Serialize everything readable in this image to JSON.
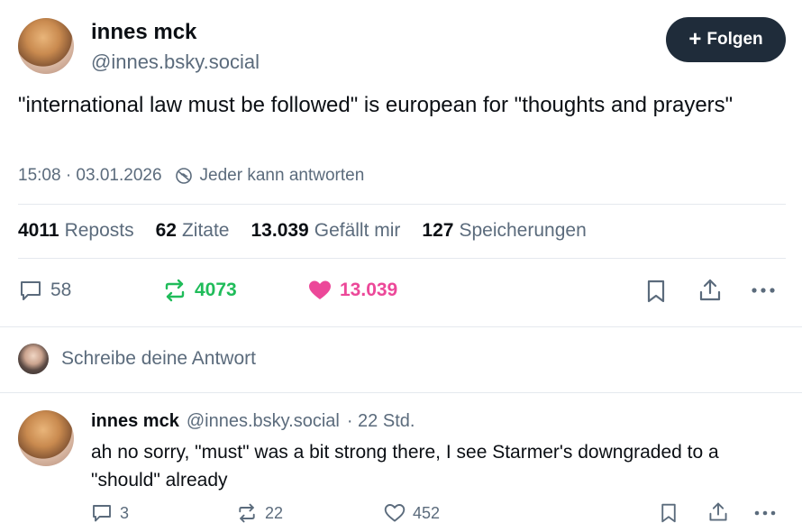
{
  "post": {
    "author_name": "innes mck",
    "author_handle": "@innes.bsky.social",
    "follow_label": "Folgen",
    "text": "\"international law must be followed\" is european for \"thoughts and prayers\"",
    "timestamp": "15:08 · 03.01.2026",
    "reply_permission": "Jeder kann antworten",
    "stats": [
      {
        "value": "4011",
        "label": "Reposts"
      },
      {
        "value": "62",
        "label": "Zitate"
      },
      {
        "value": "13.039",
        "label": "Gefällt mir"
      },
      {
        "value": "127",
        "label": "Speicherungen"
      }
    ],
    "actions": {
      "replies": "58",
      "reposts": "4073",
      "likes": "13.039"
    }
  },
  "compose": {
    "placeholder": "Schreibe deine Antwort"
  },
  "reply": {
    "author_name": "innes mck",
    "author_handle": "@innes.bsky.social",
    "time": "· 22 Std.",
    "text": "ah no sorry, \"must\" was a bit strong there, I see Starmer's downgraded to a \"should\" already",
    "actions": {
      "replies": "3",
      "reposts": "22",
      "likes": "452"
    }
  },
  "colors": {
    "repost_active": "#20bc5a",
    "like_active": "#ec4899",
    "follow_bg": "#1f2c3a",
    "muted": "#5b6b7c"
  }
}
